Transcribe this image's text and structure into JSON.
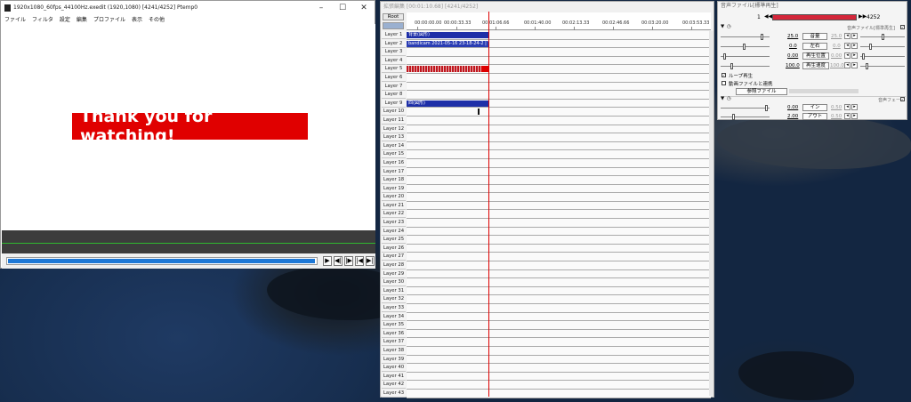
{
  "main_window": {
    "title": "1920x1080_60fps_44100Hz.exedit (1920,1080)  [4241/4252]  Ptemp0",
    "menu": [
      "ファイル",
      "フィルタ",
      "設定",
      "編集",
      "プロファイル",
      "表示",
      "その他"
    ],
    "preview_text": "Thank you for watching!",
    "controls": [
      "▶",
      "◀|",
      "|▶",
      "|◀",
      "▶|"
    ],
    "seek_progress": 0.997,
    "accent_color": "#e00000"
  },
  "timeline": {
    "title": "拡張編集 [00:01:10.68] [4241/4252]",
    "root_label": "Root",
    "ticks": [
      "00:00:00.00",
      "00:00:33.33",
      "00:01:06.66",
      "00:01:40.00",
      "00:02:13.33",
      "00:02:46.66",
      "00:03:20.00",
      "00:03:53.33"
    ],
    "layers": [
      "Layer 1",
      "Layer 2",
      "Layer 3",
      "Layer 4",
      "Layer 5",
      "Layer 6",
      "Layer 7",
      "Layer 8",
      "Layer 9",
      "Layer 10",
      "Layer 11",
      "Layer 12",
      "Layer 13",
      "Layer 14",
      "Layer 15",
      "Layer 16",
      "Layer 17",
      "Layer 18",
      "Layer 19",
      "Layer 20",
      "Layer 21",
      "Layer 22",
      "Layer 23",
      "Layer 24",
      "Layer 25",
      "Layer 26",
      "Layer 27",
      "Layer 28",
      "Layer 29",
      "Layer 30",
      "Layer 31",
      "Layer 32",
      "Layer 33",
      "Layer 34",
      "Layer 35",
      "Layer 36",
      "Layer 37",
      "Layer 38",
      "Layer 39",
      "Layer 40",
      "Layer 41",
      "Layer 42",
      "Layer 43"
    ],
    "clip_layer1": "背景(図形)",
    "clip_layer2": "bandicam 2021-05-16 23-18-24-2 | Tha",
    "clip_layer9": "四(図形)"
  },
  "settings_window": {
    "title": "音声ファイル[標準再生]",
    "frame_start": "1",
    "frame_end": "4252",
    "checkbox_audio_file": "音声ファイル[標準再生]",
    "values": {
      "volume_left": "25.0",
      "volume_right": "25.0",
      "volume_label": "音量",
      "pan_left": "0.0",
      "pan_right": "0.0",
      "pan_label": "左右",
      "pos_left": "0.00",
      "pos_right": "0.00",
      "pos_label": "再生位置",
      "speed_left": "100.0",
      "speed_right": "100.0",
      "speed_label": "再生速度"
    },
    "loop_label": "ループ再生",
    "link_label": "動画ファイルと連携",
    "ref_button": "参照ファイル",
    "fade_label": "音声フェード",
    "fade": {
      "in_left": "0.00",
      "in_right": "0.50",
      "in_label": "イン",
      "out_left": "2.00",
      "out_right": "0.50",
      "out_label": "アウト"
    }
  }
}
